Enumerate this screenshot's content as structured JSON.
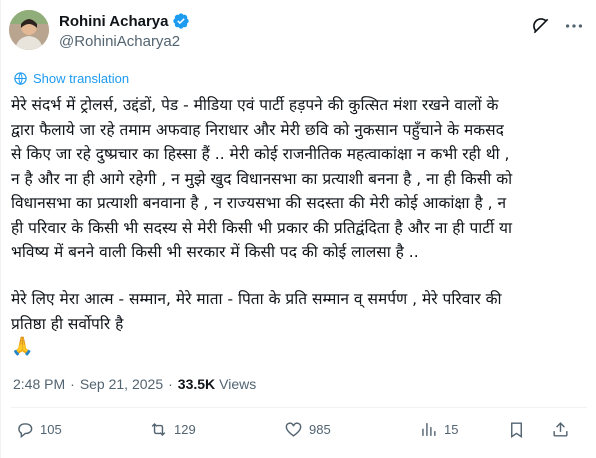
{
  "author": {
    "name": "Rohini Acharya",
    "handle": "@RohiniAcharya2"
  },
  "translate_label": "Show translation",
  "body": {
    "paragraph1": "मेरे संदर्भ में ट्रोलर्स, उद्दंडों, पेड - मीडिया एवं पार्टी हड़पने की कुत्सित मंशा रखने वालों के\nद्वारा फैलाये जा रहे तमाम अफवाह निराधार और मेरी छवि को नुकसान पहुँचाने के मकसद\nसे किए जा रहे दुष्प्रचार का हिस्सा हैं .. मेरी कोई राजनीतिक महत्वाकांक्षा न कभी रही थी ,\nन है और ना ही आगे रहेगी , न मुझे खुद विधानसभा का प्रत्याशी बनना है , ना ही किसी को\nविधानसभा का प्रत्याशी बनवाना है , न राज्यसभा की सदस्ता की मेरी कोई आकांक्षा है , न\nही परिवार के किसी भी सदस्य से मेरी किसी भी प्रकार की प्रतिद्वंदिता है और ना ही पार्टी या\nभविष्य में बनने वाली किसी भी सरकार में किसी पद की कोई लालसा है ..",
    "paragraph2": "मेरे लिए मेरा आत्म - सम्मान, मेरे माता - पिता के प्रति सम्मान व् समर्पण , मेरे परिवार की\nप्रतिष्ठा ही सर्वोपरि है",
    "emoji": "🙏"
  },
  "meta": {
    "time": "2:48 PM",
    "date": "Sep 21, 2025",
    "views_count": "33.5K",
    "views_label": "Views"
  },
  "actions": {
    "replies": "105",
    "reposts": "129",
    "likes": "985",
    "bookmarks": "15"
  },
  "colors": {
    "accent": "#1d9bf0",
    "muted": "#536471",
    "text": "#0f1419"
  }
}
